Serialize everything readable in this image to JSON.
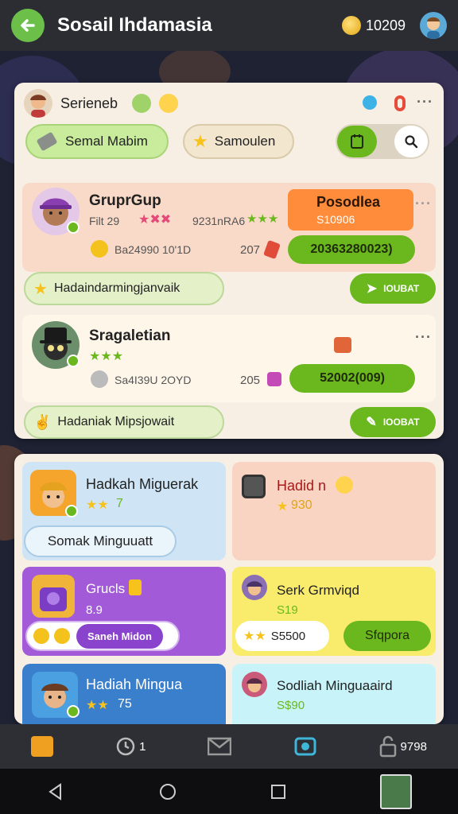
{
  "header": {
    "title": "Sosail Ihdamasia",
    "coins": "10209"
  },
  "panel1": {
    "user_name": "Serieneb",
    "filters": {
      "first": "Semal Mabim",
      "second": "Samoulen"
    },
    "cards": [
      {
        "name": "GruprGup",
        "meta": "Filt 29",
        "meta2": "9231nRA6",
        "stat": "Ba24990 10'1D",
        "count": "207",
        "badge_title": "Posodlea",
        "badge_value": "S10906",
        "green_value": "20363280023)",
        "banner": "Hadaindarmingjanvaik",
        "banner_btn": "IOUBAT"
      },
      {
        "name": "Sragaletian",
        "stat": "Sa4I39U 2OYD",
        "count": "205",
        "green_value": "52002(009)",
        "banner": "Hadaniak Mipsjowait",
        "banner_btn": "IOOBAT"
      }
    ]
  },
  "panel2": {
    "tiles": [
      {
        "title": "Hadkah Miguerak",
        "sub": "7",
        "pill": "Somak Minguuatt"
      },
      {
        "title": "Hadid n",
        "sub": "930"
      },
      {
        "title": "Grucls",
        "sub": "8.9",
        "pill": "Saneh Midon"
      },
      {
        "title": "Serk Grmviqd",
        "sub": "S19",
        "pill": "S5500",
        "btn": "Sfqpora"
      },
      {
        "title": "Hadiah Mingua",
        "sub": "75"
      },
      {
        "title": "Sodliah Minguaaird",
        "sub": "S$90"
      }
    ]
  },
  "bottom": {
    "item2_count": "1",
    "item5_count": "9798"
  },
  "colors": {
    "accent_green": "#6ab81e",
    "orange": "#ff8c3a",
    "purple": "#a25ad8",
    "yellow": "#f9ec6d",
    "blue": "#3a7fcc",
    "cyan": "#c8f3f8"
  }
}
